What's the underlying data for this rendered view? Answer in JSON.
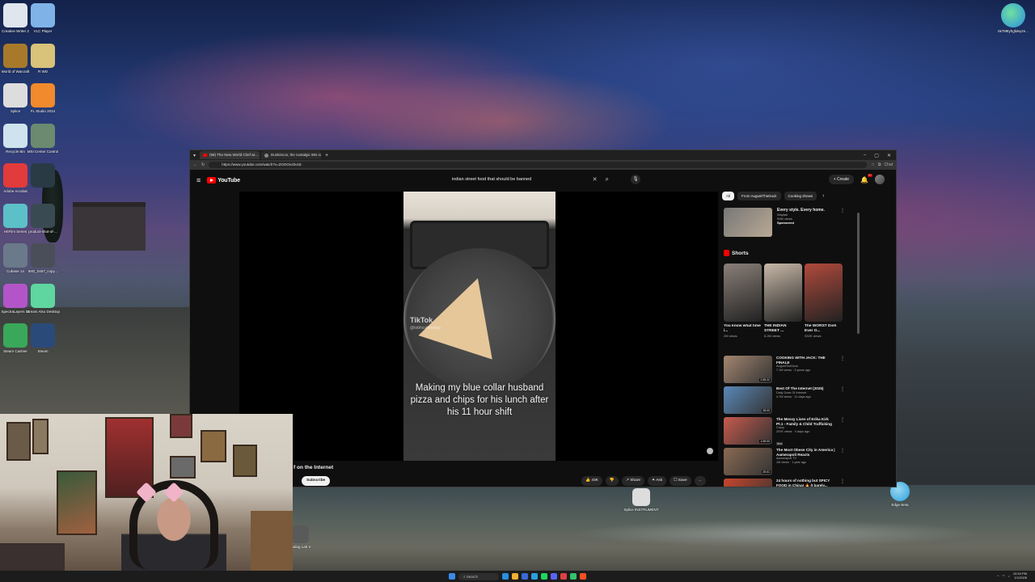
{
  "desktop": {
    "icons": [
      {
        "label": "Creative Writer 2",
        "color": "#dfe6ee"
      },
      {
        "label": "VLC Player",
        "color": "#7fb3e8"
      },
      {
        "label": "World of Warcraft",
        "color": "#a8792b"
      },
      {
        "label": "R WD",
        "color": "#d9c27a"
      },
      {
        "label": "Splice",
        "color": "#dddddd"
      },
      {
        "label": "FL Studio 2024",
        "color": "#f08a2c"
      },
      {
        "label": "Recycle Bin",
        "color": "#cfe3ee"
      },
      {
        "label": "MSI Center Control",
        "color": "#6b8a6f"
      },
      {
        "label": "Adobe Acrobat",
        "color": "#e23b3b"
      },
      {
        "label": "",
        "color": "#2a3a45"
      },
      {
        "label": "HitFilm Series",
        "color": "#5cc0c8"
      },
      {
        "label": "product-shot-of-...",
        "color": "#3a4a52"
      },
      {
        "label": "Cubase 14",
        "color": "#6a7a8a"
      },
      {
        "label": "IMG_0457_copy...",
        "color": "#4a4e58"
      },
      {
        "label": "SpectraLayers 11",
        "color": "#b355c8"
      },
      {
        "label": "Stream Also Desktop",
        "color": "#5fd6a0"
      },
      {
        "label": "Steam Cashier",
        "color": "#3aa85a"
      },
      {
        "label": "Steam",
        "color": "#2a4a7a"
      }
    ],
    "right_icon": {
      "label": "nk789tyhgfdey2n...",
      "color": "#2a8fe0"
    },
    "bottom_icons": [
      {
        "label": "Splice INSTRUMENT",
        "color": "#dddddd"
      },
      {
        "label": "Edge Beta",
        "color": "#2aa0e0"
      },
      {
        "label": "Analog Lab V",
        "color": "#5a5a5a"
      }
    ]
  },
  "browser": {
    "tabs": [
      {
        "label": "(98) The New World Chef wi...",
        "active": true
      },
      {
        "label": "Dunkincos, the nostalgic 90s sca...",
        "active": false
      }
    ],
    "url": "https://www.youtube.com/watch?v=ZOOOnzbv1E",
    "profile_label": "Chat"
  },
  "youtube": {
    "logo": "YouTube",
    "search_query": "indian street food that should be banned",
    "create_label": "Create",
    "notif_count": "9+",
    "video": {
      "overlay_logo": "TikTok",
      "overlay_handle": "@tobhcuttesetup",
      "caption": "Making my blue collar husband pizza and chips for his lunch after his 11 hour shift",
      "title_fragment": "f on the Internet",
      "subscribe_label": "Subscribe",
      "actions": [
        "43K",
        "",
        "Share",
        "Ask",
        "Save",
        "..."
      ]
    },
    "chips": [
      "All",
      "From AugustTheDuck",
      "Cooking shows"
    ],
    "ad": {
      "title": "Every style. Every home.",
      "advertiser": "Wayfair",
      "views": "99M views",
      "sponsored": "Sponsored",
      "duration": "0:15"
    },
    "shorts_header": "Shorts",
    "shorts": [
      {
        "title": "You know what time i...",
        "views": "2M views",
        "color": "#8a7f78"
      },
      {
        "title": "THE INDIAN STREET ...",
        "views": "8.2M views",
        "color": "#c9b9a8"
      },
      {
        "title": "The WORST Dish Ever O...",
        "views": "332K views",
        "color": "#b04a3c"
      }
    ],
    "recommended": [
      {
        "title": "COOKING WITH JACK: THE FINALE",
        "channel": "AugustTheDuck",
        "meta": "7.1M views · 3 years ago",
        "duration": "2:55:22",
        "badge": "",
        "color": "#a48670"
      },
      {
        "title": "Best Of The Internet (2025)",
        "channel": "Daily Dose Of Internet",
        "meta": "4.7M views · 11 days ago",
        "duration": "28:00",
        "badge": "",
        "color": "#5a88b8"
      },
      {
        "title": "The Messy Lives of Erika Kirk Pt.1 - Family & Child Trafficking",
        "channel": "Crazy",
        "meta": "201K views · 4 days ago",
        "duration": "1:05:00",
        "badge": "New",
        "color": "#c85a4e"
      },
      {
        "title": "The Most Obese City in America | Aamerapoli Reacts",
        "channel": "Aamerapoli TV",
        "meta": "1M views · 1 year ago",
        "duration": "25:01",
        "badge": "",
        "color": "#8a6a52"
      },
      {
        "title": "24 hours of nothing but SPICY FOOD in China! 🔥 (I barely...",
        "channel": "",
        "meta": "",
        "duration": "",
        "badge": "",
        "color": "#c8462c"
      }
    ]
  },
  "taskbar": {
    "search_label": "Search",
    "time": "10:34 PM",
    "date": "1/1/2026",
    "apps": [
      "#2a8fe0",
      "#f0b030",
      "#3a6ad8",
      "#2aa0e0",
      "#1ed760",
      "#5865f2",
      "#e04040",
      "#32c36c",
      "#f25022"
    ]
  }
}
